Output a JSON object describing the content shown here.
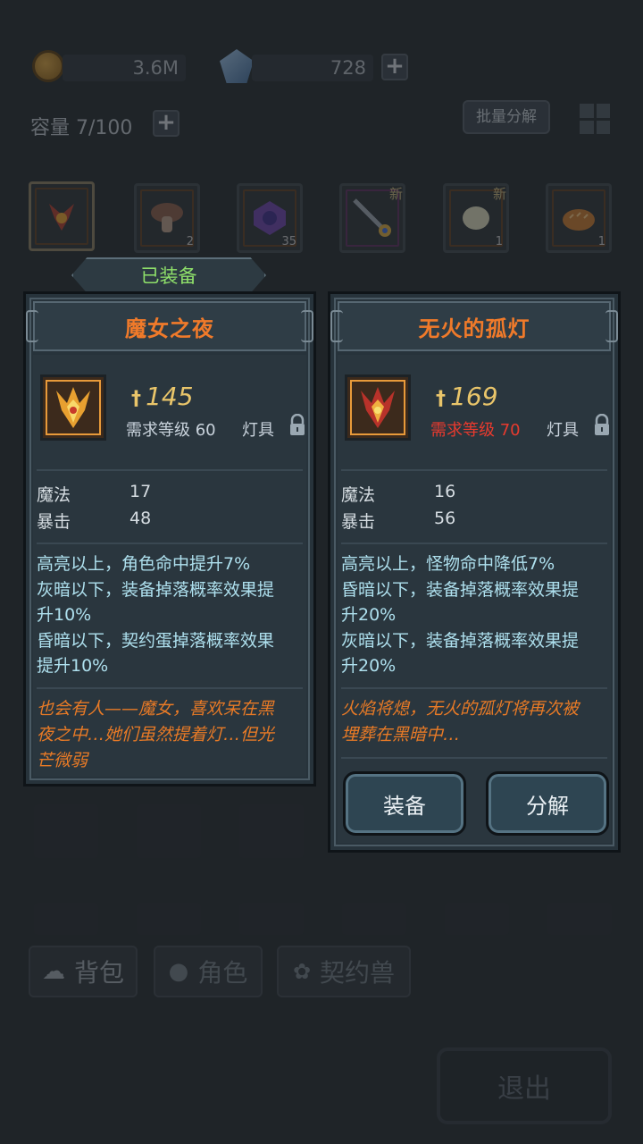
{
  "resources": {
    "gold": "3.6M",
    "crystal": "728",
    "capacity": "容量 7/100",
    "batch_label": "批量分解"
  },
  "inventory": {
    "slots": [
      {
        "count": "",
        "badge": "",
        "icon": "lamp-claw-icon"
      },
      {
        "count": "2",
        "badge": "",
        "icon": "mushroom-icon"
      },
      {
        "count": "35",
        "badge": "",
        "icon": "purple-gem-icon"
      },
      {
        "count": "",
        "badge": "新",
        "icon": "staff-icon"
      },
      {
        "count": "1",
        "badge": "新",
        "icon": "egg-icon"
      },
      {
        "count": "1",
        "badge": "",
        "icon": "bread-icon"
      }
    ]
  },
  "equipped_label": "已装备",
  "card_left": {
    "title": "魔女之夜",
    "power": "145",
    "req": "需求等级 60",
    "category": "灯具",
    "stats": [
      {
        "name": "魔法",
        "value": "17"
      },
      {
        "name": "暴击",
        "value": "48"
      }
    ],
    "effects": [
      "高亮以上，角色命中提升7%",
      "灰暗以下，装备掉落概率效果提",
      "升10%",
      "昏暗以下，契约蛋掉落概率效果",
      "提升10%"
    ],
    "lore": [
      "也会有人——魔女，喜欢呆在黑",
      "夜之中…她们虽然提着灯…但光",
      "芒微弱"
    ]
  },
  "card_right": {
    "title": "无火的孤灯",
    "power": "169",
    "req": "需求等级 70",
    "category": "灯具",
    "stats": [
      {
        "name": "魔法",
        "value": "16"
      },
      {
        "name": "暴击",
        "value": "56"
      }
    ],
    "effects": [
      "高亮以上，怪物命中降低7%",
      "昏暗以下，装备掉落概率效果提",
      "升20%",
      "灰暗以下，装备掉落概率效果提",
      "升20%"
    ],
    "lore": [
      "火焰将熄，无火的孤灯将再次被",
      "埋葬在黑暗中…"
    ],
    "equip_button": "装备",
    "decompose_button": "分解"
  },
  "tabs": {
    "bag": "背包",
    "role": "角色",
    "pet": "契约兽"
  },
  "exit_label": "退出",
  "colors": {
    "title": "#f07a2a",
    "power": "#e9c56a",
    "effect": "#aee0ee",
    "lore": "#e87a26",
    "requirement_unmet": "#e83a2e",
    "equipped": "#8fe06a"
  }
}
